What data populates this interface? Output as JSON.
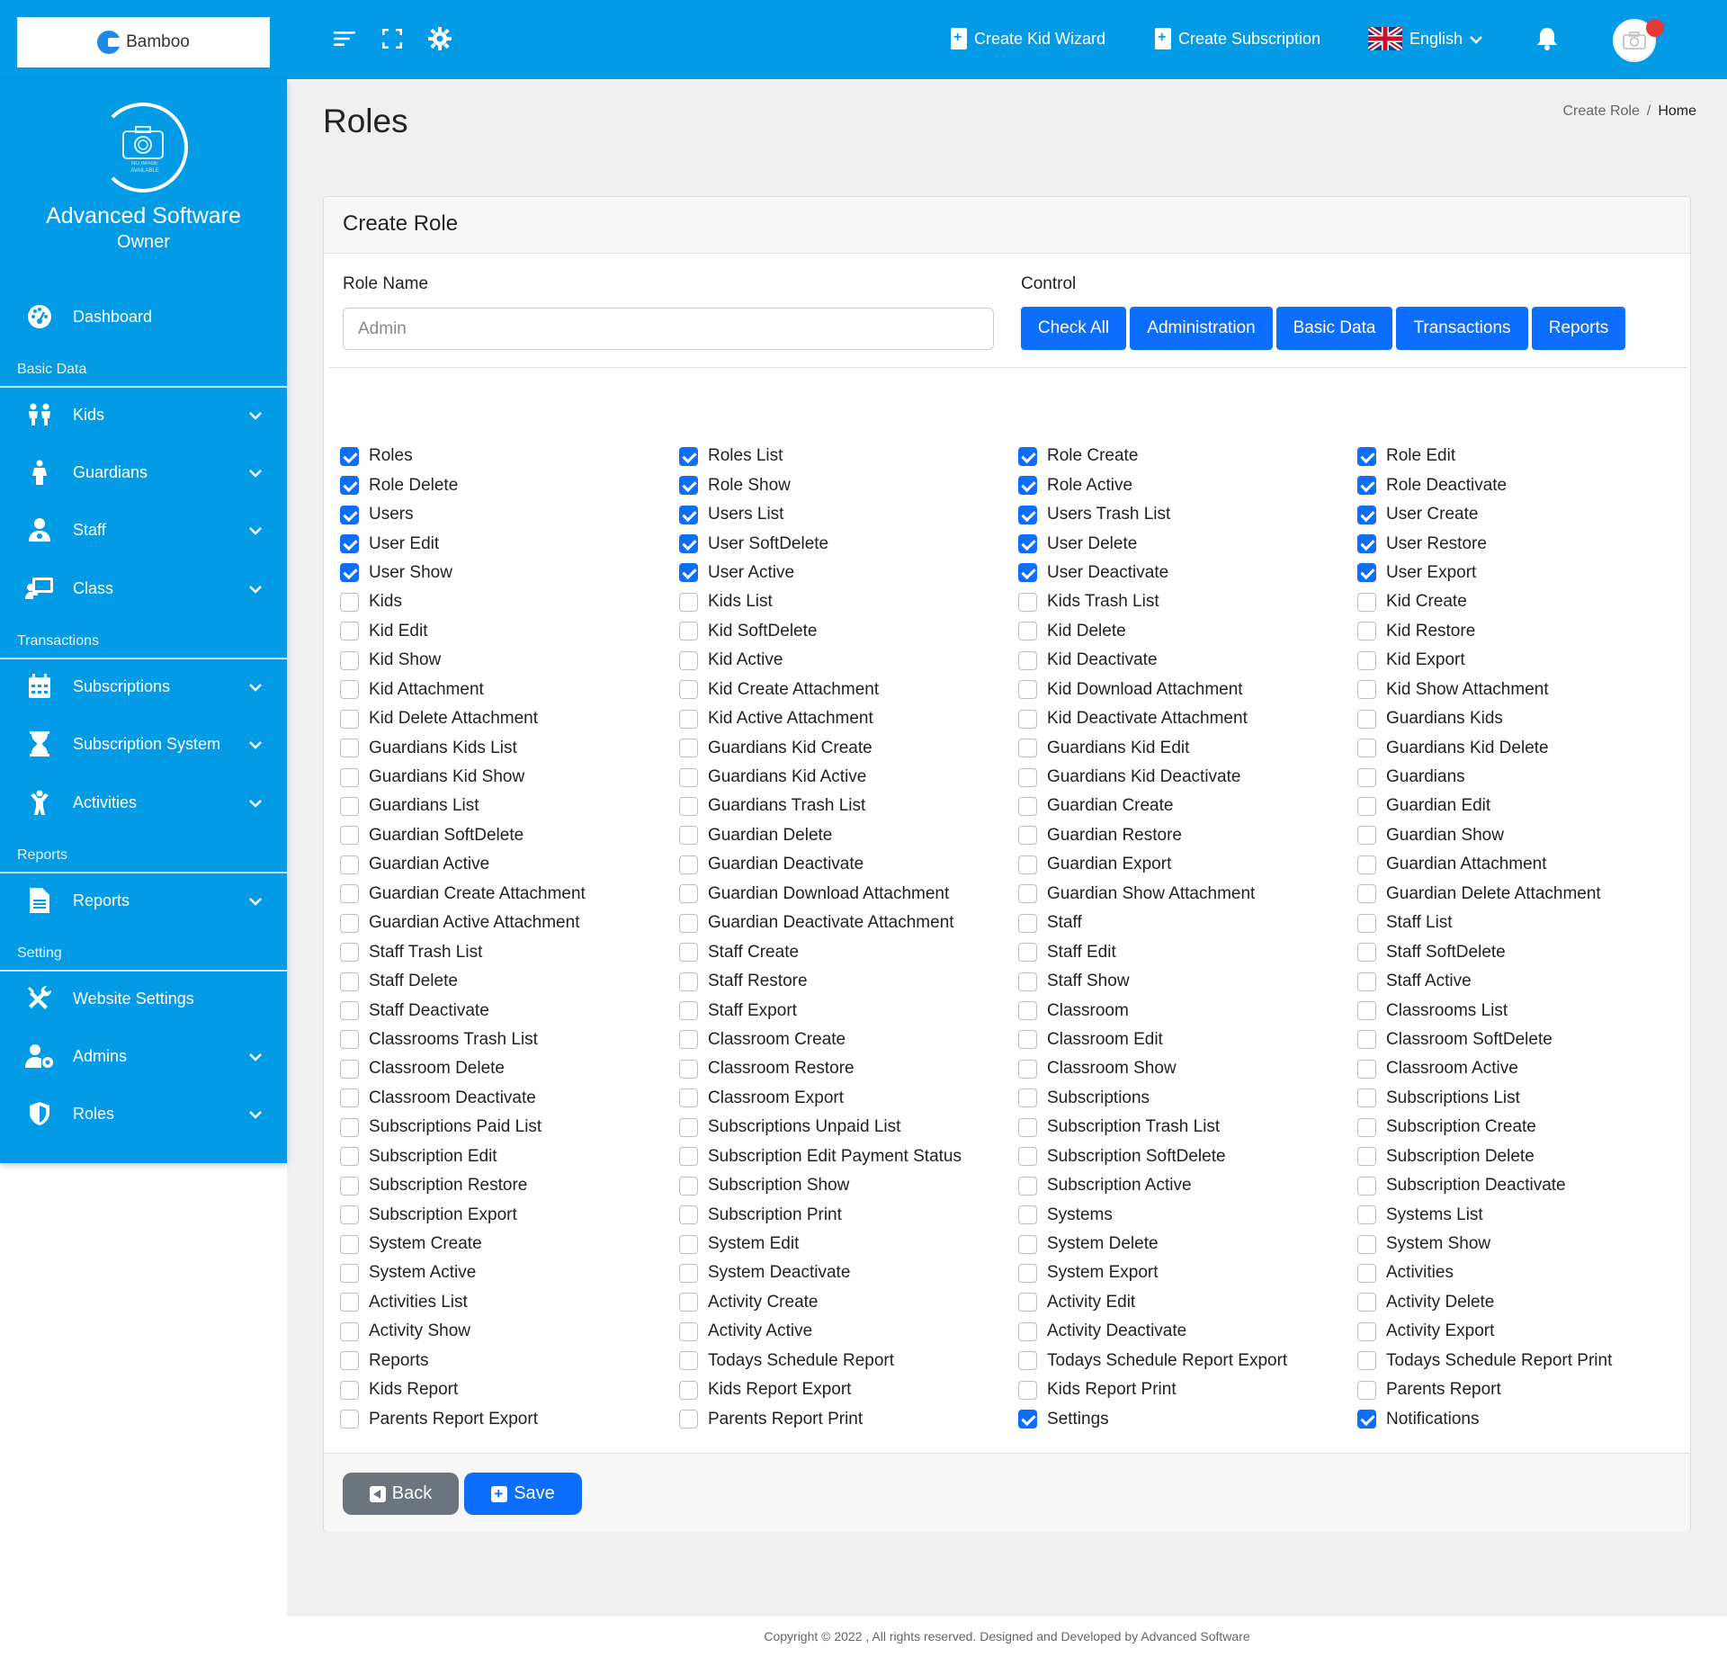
{
  "brand": {
    "logo_text": "Bamboo"
  },
  "topbar": {
    "create_kid_wizard": "Create Kid Wizard",
    "create_subscription": "Create Subscription",
    "language": "English"
  },
  "profile": {
    "image_caption": "NO IMAGE AVAILABLE",
    "name": "Advanced Software",
    "role": "Owner"
  },
  "sidebar": {
    "dashboard": "Dashboard",
    "sections": {
      "basic_data": "Basic Data",
      "transactions": "Transactions",
      "reports": "Reports",
      "setting": "Setting"
    },
    "items": {
      "kids": "Kids",
      "guardians": "Guardians",
      "staff": "Staff",
      "class": "Class",
      "subscriptions": "Subscriptions",
      "subscription_system": "Subscription System",
      "activities": "Activities",
      "reports": "Reports",
      "website_settings": "Website Settings",
      "admins": "Admins",
      "roles": "Roles"
    }
  },
  "page": {
    "title": "Roles",
    "breadcrumb": {
      "current": "Create Role",
      "separator": "/",
      "home": "Home"
    }
  },
  "form": {
    "card_title": "Create Role",
    "role_name_label": "Role Name",
    "role_name_placeholder": "Admin",
    "control_label": "Control",
    "controls": {
      "check_all": "Check All",
      "administration": "Administration",
      "basic_data": "Basic Data",
      "transactions": "Transactions",
      "reports": "Reports"
    },
    "back_label": "Back",
    "save_label": "Save"
  },
  "permissions": [
    {
      "label": "Roles",
      "checked": true
    },
    {
      "label": "Roles List",
      "checked": true
    },
    {
      "label": "Role Create",
      "checked": true
    },
    {
      "label": "Role Edit",
      "checked": true
    },
    {
      "label": "Role Delete",
      "checked": true
    },
    {
      "label": "Role Show",
      "checked": true
    },
    {
      "label": "Role Active",
      "checked": true
    },
    {
      "label": "Role Deactivate",
      "checked": true
    },
    {
      "label": "Users",
      "checked": true
    },
    {
      "label": "Users List",
      "checked": true
    },
    {
      "label": "Users Trash List",
      "checked": true
    },
    {
      "label": "User Create",
      "checked": true
    },
    {
      "label": "User Edit",
      "checked": true
    },
    {
      "label": "User SoftDelete",
      "checked": true
    },
    {
      "label": "User Delete",
      "checked": true
    },
    {
      "label": "User Restore",
      "checked": true
    },
    {
      "label": "User Show",
      "checked": true
    },
    {
      "label": "User Active",
      "checked": true
    },
    {
      "label": "User Deactivate",
      "checked": true
    },
    {
      "label": "User Export",
      "checked": true
    },
    {
      "label": "Kids",
      "checked": false
    },
    {
      "label": "Kids List",
      "checked": false
    },
    {
      "label": "Kids Trash List",
      "checked": false
    },
    {
      "label": "Kid Create",
      "checked": false
    },
    {
      "label": "Kid Edit",
      "checked": false
    },
    {
      "label": "Kid SoftDelete",
      "checked": false
    },
    {
      "label": "Kid Delete",
      "checked": false
    },
    {
      "label": "Kid Restore",
      "checked": false
    },
    {
      "label": "Kid Show",
      "checked": false
    },
    {
      "label": "Kid Active",
      "checked": false
    },
    {
      "label": "Kid Deactivate",
      "checked": false
    },
    {
      "label": "Kid Export",
      "checked": false
    },
    {
      "label": "Kid Attachment",
      "checked": false
    },
    {
      "label": "Kid Create Attachment",
      "checked": false
    },
    {
      "label": "Kid Download Attachment",
      "checked": false
    },
    {
      "label": "Kid Show Attachment",
      "checked": false
    },
    {
      "label": "Kid Delete Attachment",
      "checked": false
    },
    {
      "label": "Kid Active Attachment",
      "checked": false
    },
    {
      "label": "Kid Deactivate Attachment",
      "checked": false
    },
    {
      "label": "Guardians Kids",
      "checked": false
    },
    {
      "label": "Guardians Kids List",
      "checked": false
    },
    {
      "label": "Guardians Kid Create",
      "checked": false
    },
    {
      "label": "Guardians Kid Edit",
      "checked": false
    },
    {
      "label": "Guardians Kid Delete",
      "checked": false
    },
    {
      "label": "Guardians Kid Show",
      "checked": false
    },
    {
      "label": "Guardians Kid Active",
      "checked": false
    },
    {
      "label": "Guardians Kid Deactivate",
      "checked": false
    },
    {
      "label": "Guardians",
      "checked": false
    },
    {
      "label": "Guardians List",
      "checked": false
    },
    {
      "label": "Guardians Trash List",
      "checked": false
    },
    {
      "label": "Guardian Create",
      "checked": false
    },
    {
      "label": "Guardian Edit",
      "checked": false
    },
    {
      "label": "Guardian SoftDelete",
      "checked": false
    },
    {
      "label": "Guardian Delete",
      "checked": false
    },
    {
      "label": "Guardian Restore",
      "checked": false
    },
    {
      "label": "Guardian Show",
      "checked": false
    },
    {
      "label": "Guardian Active",
      "checked": false
    },
    {
      "label": "Guardian Deactivate",
      "checked": false
    },
    {
      "label": "Guardian Export",
      "checked": false
    },
    {
      "label": "Guardian Attachment",
      "checked": false
    },
    {
      "label": "Guardian Create Attachment",
      "checked": false
    },
    {
      "label": "Guardian Download Attachment",
      "checked": false
    },
    {
      "label": "Guardian Show Attachment",
      "checked": false
    },
    {
      "label": "Guardian Delete Attachment",
      "checked": false
    },
    {
      "label": "Guardian Active Attachment",
      "checked": false
    },
    {
      "label": "Guardian Deactivate Attachment",
      "checked": false
    },
    {
      "label": "Staff",
      "checked": false
    },
    {
      "label": "Staff List",
      "checked": false
    },
    {
      "label": "Staff Trash List",
      "checked": false
    },
    {
      "label": "Staff Create",
      "checked": false
    },
    {
      "label": "Staff Edit",
      "checked": false
    },
    {
      "label": "Staff SoftDelete",
      "checked": false
    },
    {
      "label": "Staff Delete",
      "checked": false
    },
    {
      "label": "Staff Restore",
      "checked": false
    },
    {
      "label": "Staff Show",
      "checked": false
    },
    {
      "label": "Staff Active",
      "checked": false
    },
    {
      "label": "Staff Deactivate",
      "checked": false
    },
    {
      "label": "Staff Export",
      "checked": false
    },
    {
      "label": "Classroom",
      "checked": false
    },
    {
      "label": "Classrooms List",
      "checked": false
    },
    {
      "label": "Classrooms Trash List",
      "checked": false
    },
    {
      "label": "Classroom Create",
      "checked": false
    },
    {
      "label": "Classroom Edit",
      "checked": false
    },
    {
      "label": "Classroom SoftDelete",
      "checked": false
    },
    {
      "label": "Classroom Delete",
      "checked": false
    },
    {
      "label": "Classroom Restore",
      "checked": false
    },
    {
      "label": "Classroom Show",
      "checked": false
    },
    {
      "label": "Classroom Active",
      "checked": false
    },
    {
      "label": "Classroom Deactivate",
      "checked": false
    },
    {
      "label": "Classroom Export",
      "checked": false
    },
    {
      "label": "Subscriptions",
      "checked": false
    },
    {
      "label": "Subscriptions List",
      "checked": false
    },
    {
      "label": "Subscriptions Paid List",
      "checked": false
    },
    {
      "label": "Subscriptions Unpaid List",
      "checked": false
    },
    {
      "label": "Subscription Trash List",
      "checked": false
    },
    {
      "label": "Subscription Create",
      "checked": false
    },
    {
      "label": "Subscription Edit",
      "checked": false
    },
    {
      "label": "Subscription Edit Payment Status",
      "checked": false
    },
    {
      "label": "Subscription SoftDelete",
      "checked": false
    },
    {
      "label": "Subscription Delete",
      "checked": false
    },
    {
      "label": "Subscription Restore",
      "checked": false
    },
    {
      "label": "Subscription Show",
      "checked": false
    },
    {
      "label": "Subscription Active",
      "checked": false
    },
    {
      "label": "Subscription Deactivate",
      "checked": false
    },
    {
      "label": "Subscription Export",
      "checked": false
    },
    {
      "label": "Subscription Print",
      "checked": false
    },
    {
      "label": "Systems",
      "checked": false
    },
    {
      "label": "Systems List",
      "checked": false
    },
    {
      "label": "System Create",
      "checked": false
    },
    {
      "label": "System Edit",
      "checked": false
    },
    {
      "label": "System Delete",
      "checked": false
    },
    {
      "label": "System Show",
      "checked": false
    },
    {
      "label": "System Active",
      "checked": false
    },
    {
      "label": "System Deactivate",
      "checked": false
    },
    {
      "label": "System Export",
      "checked": false
    },
    {
      "label": "Activities",
      "checked": false
    },
    {
      "label": "Activities List",
      "checked": false
    },
    {
      "label": "Activity Create",
      "checked": false
    },
    {
      "label": "Activity Edit",
      "checked": false
    },
    {
      "label": "Activity Delete",
      "checked": false
    },
    {
      "label": "Activity Show",
      "checked": false
    },
    {
      "label": "Activity Active",
      "checked": false
    },
    {
      "label": "Activity Deactivate",
      "checked": false
    },
    {
      "label": "Activity Export",
      "checked": false
    },
    {
      "label": "Reports",
      "checked": false
    },
    {
      "label": "Todays Schedule Report",
      "checked": false
    },
    {
      "label": "Todays Schedule Report Export",
      "checked": false
    },
    {
      "label": "Todays Schedule Report Print",
      "checked": false
    },
    {
      "label": "Kids Report",
      "checked": false
    },
    {
      "label": "Kids Report Export",
      "checked": false
    },
    {
      "label": "Kids Report Print",
      "checked": false
    },
    {
      "label": "Parents Report",
      "checked": false
    },
    {
      "label": "Parents Report Export",
      "checked": false
    },
    {
      "label": "Parents Report Print",
      "checked": false
    },
    {
      "label": "Settings",
      "checked": true
    },
    {
      "label": "Notifications",
      "checked": true
    }
  ],
  "footer": {
    "copyright": "Copyright © 2022 , All rights reserved. Designed and Developed by Advanced Software"
  },
  "colors": {
    "primary": "#039be5",
    "button": "#0d6efd",
    "back_button": "#6c757d",
    "notification_dot": "#e53935"
  }
}
